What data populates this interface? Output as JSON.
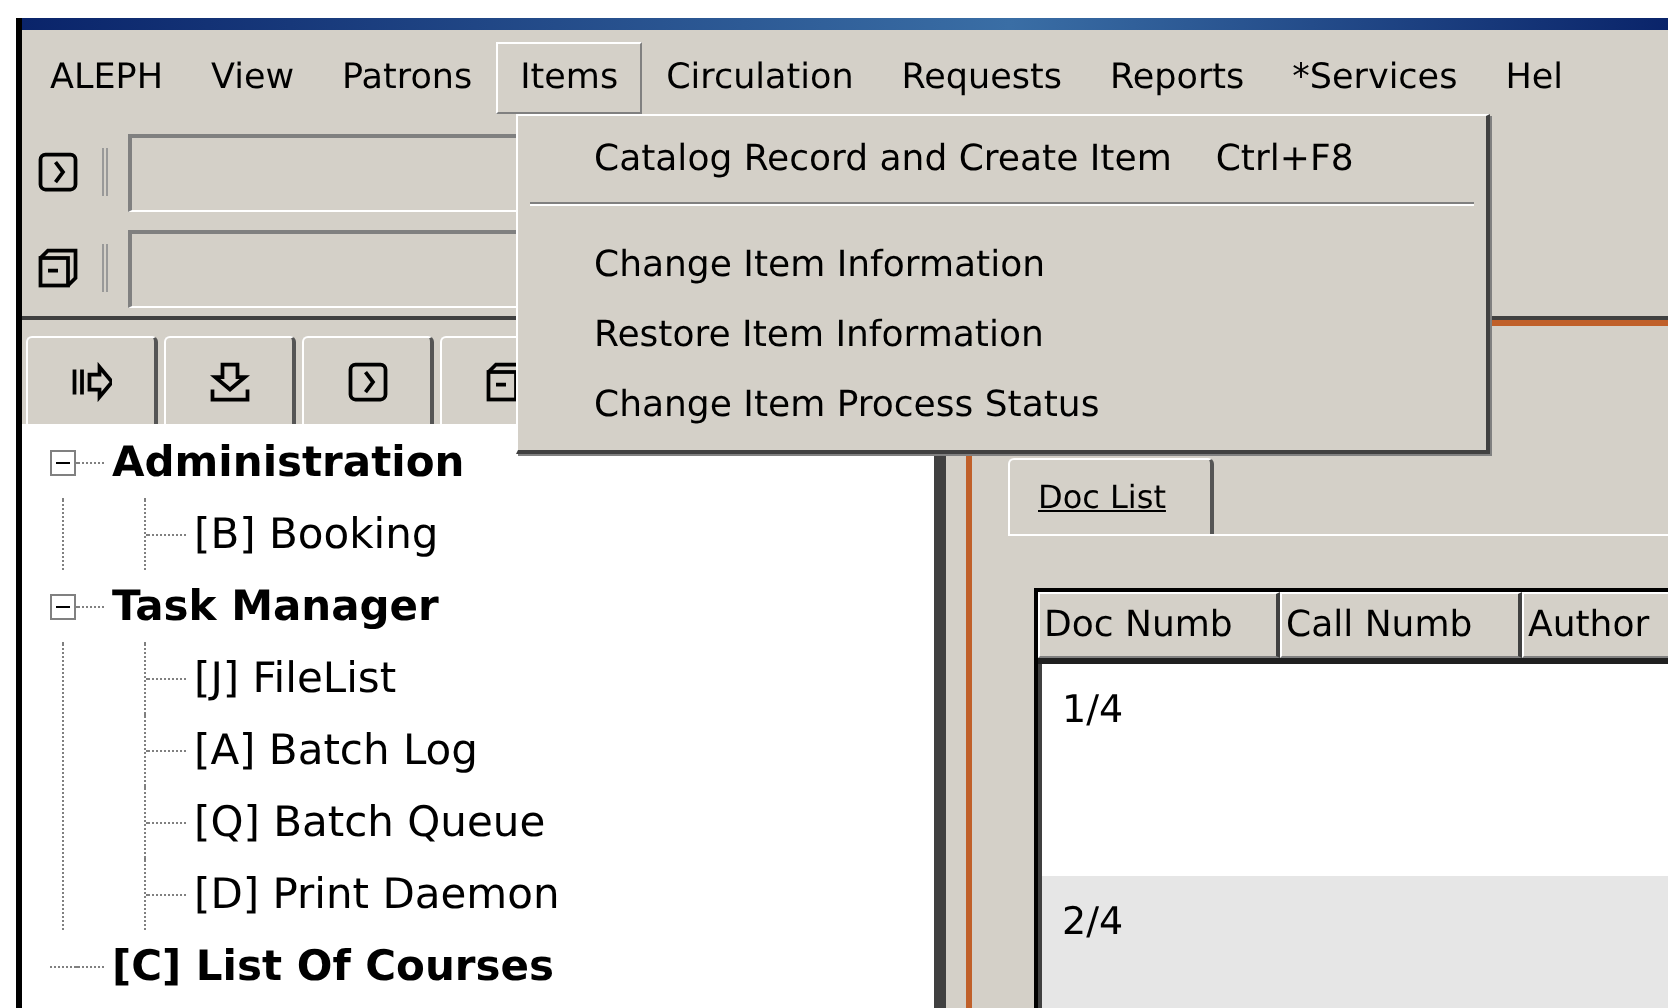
{
  "menu_bar": [
    {
      "label": "ALEPH",
      "selected": false
    },
    {
      "label": "View",
      "selected": false
    },
    {
      "label": "Patrons",
      "selected": false
    },
    {
      "label": "Items",
      "selected": true
    },
    {
      "label": "Circulation",
      "selected": false
    },
    {
      "label": "Requests",
      "selected": false
    },
    {
      "label": "Reports",
      "selected": false
    },
    {
      "label": "*Services",
      "selected": false
    },
    {
      "label": "Hel",
      "selected": false
    }
  ],
  "items_menu": [
    {
      "kind": "item",
      "label": "Catalog Record and Create Item",
      "shortcut": "Ctrl+F8"
    },
    {
      "kind": "separator"
    },
    {
      "kind": "item",
      "label": "Change Item Information"
    },
    {
      "kind": "item",
      "label": "Restore Item Information"
    },
    {
      "kind": "item",
      "label": "Change Item Process Status"
    }
  ],
  "tree": [
    {
      "label": "Administration",
      "expanded": true,
      "children": [
        {
          "label": "[B] Booking"
        }
      ]
    },
    {
      "label": "Task Manager",
      "expanded": true,
      "children": [
        {
          "label": "[J] FileList"
        },
        {
          "label": "[A] Batch Log"
        },
        {
          "label": "[Q] Batch Queue"
        },
        {
          "label": "[D] Print Daemon"
        }
      ]
    },
    {
      "label": "[C] List Of Courses"
    }
  ],
  "doc_tabs": [
    {
      "label": "Doc List",
      "selected": true
    }
  ],
  "doc_table": {
    "columns": [
      "Doc Numb",
      "Call Numb",
      "Author"
    ],
    "rows": [
      {
        "cells": [
          "1/4"
        ],
        "selected": false
      },
      {
        "cells": [
          "2/4"
        ],
        "selected": true
      }
    ]
  }
}
